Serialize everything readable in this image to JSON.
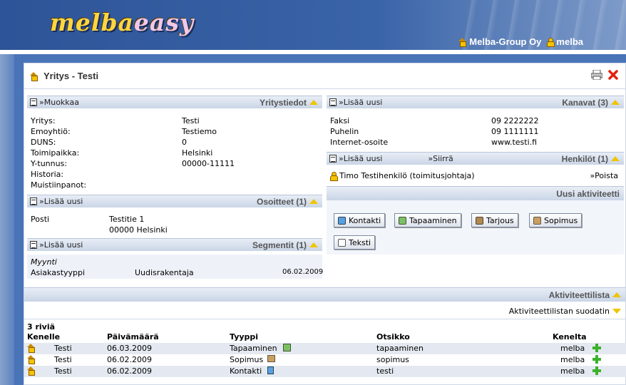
{
  "app": {
    "logo_part1": "melba",
    "logo_part2": "easy",
    "company": "Melba-Group Oy",
    "user": "melba"
  },
  "page": {
    "title": "Yritys - Testi"
  },
  "company": {
    "edit_link": "»Muokkaa",
    "section_title": "Yritystiedot",
    "fields": [
      {
        "label": "Yritys:",
        "value": "Testi"
      },
      {
        "label": "Emoyhtiö:",
        "value": "Testiemo"
      },
      {
        "label": "DUNS:",
        "value": "0"
      },
      {
        "label": "Toimipaikka:",
        "value": "Helsinki"
      },
      {
        "label": "Y-tunnus:",
        "value": "00000-11111"
      },
      {
        "label": "Historia:",
        "value": ""
      },
      {
        "label": "Muistiinpanot:",
        "value": ""
      }
    ]
  },
  "addresses": {
    "add_link": "»Lisää uusi",
    "section_title": "Osoitteet (1)",
    "type": "Posti",
    "street": "Testitie 1",
    "city": "00000 Helsinki"
  },
  "segments": {
    "add_link": "»Lisää uusi",
    "section_title": "Segmentit (1)",
    "category": "Myynti",
    "label": "Asiakastyyppi",
    "value": "Uudisrakentaja",
    "date": "06.02.2009"
  },
  "channels": {
    "add_link": "»Lisää uusi",
    "section_title": "Kanavat (3)",
    "items": [
      {
        "label": "Faksi",
        "value": "09 2222222"
      },
      {
        "label": "Puhelin",
        "value": "09 1111111"
      },
      {
        "label": "Internet-osoite",
        "value": "www.testi.fi"
      }
    ]
  },
  "persons": {
    "add_link": "»Lisää uusi",
    "move_link": "»Siirrä",
    "section_title": "Henkilöt (1)",
    "name": "Timo Testihenkilö (toimitusjohtaja)",
    "remove_link": "»Poista"
  },
  "new_activity": {
    "section_title": "Uusi aktiviteetti",
    "buttons": [
      "Kontakti",
      "Tapaaminen",
      "Tarjous",
      "Sopimus",
      "Teksti"
    ]
  },
  "activities": {
    "section_title": "Aktiviteettilista",
    "filter_label": "Aktiviteettilistan suodatin",
    "count": "3 riviä",
    "headers": [
      "Kenelle",
      "Päivämäärä",
      "Tyyppi",
      "Otsikko",
      "Kenelta"
    ],
    "rows": [
      {
        "to": "Testi",
        "date": "06.03.2009",
        "type": "Tapaaminen",
        "subject": "tapaaminen",
        "from": "melba"
      },
      {
        "to": "Testi",
        "date": "06.02.2009",
        "type": "Sopimus",
        "subject": "sopimus",
        "from": "melba"
      },
      {
        "to": "Testi",
        "date": "06.02.2009",
        "type": "Kontakti",
        "subject": "testi",
        "from": "melba"
      }
    ]
  },
  "colors": {
    "accent": "#f0c400",
    "header_bg": "#2d5497",
    "delete": "#e02010",
    "add": "#3cb22c"
  }
}
